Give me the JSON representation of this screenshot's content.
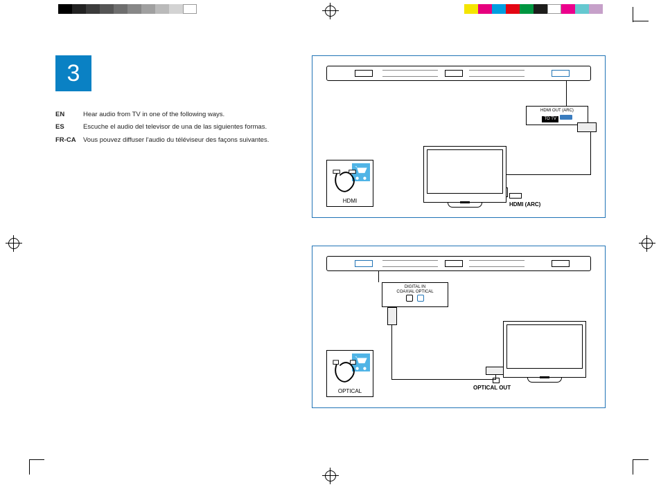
{
  "step_number": "3",
  "languages": [
    {
      "code": "EN",
      "text": "Hear audio from TV in one of the following ways."
    },
    {
      "code": "ES",
      "text": "Escuche el audio del televisor de una de las siguientes formas."
    },
    {
      "code": "FR-CA",
      "text": "Vous pouvez diffuser l'audio du téléviseur des façons suivantes."
    }
  ],
  "diagram_hdmi": {
    "cable_label": "HDMI",
    "tv_port_label": "HDMI (ARC)",
    "callout_line1": "HDMI OUT (ARC)",
    "callout_line2": "TO TV"
  },
  "diagram_optical": {
    "cable_label": "OPTICAL",
    "tv_port_label": "OPTICAL OUT",
    "callout_line1": "DIGITAL IN",
    "callout_line2": "COAXIAL   OPTICAL"
  },
  "color_bar_left": [
    "#000000",
    "#222222",
    "#3b3b3b",
    "#555555",
    "#6e6e6e",
    "#878787",
    "#a0a0a0",
    "#bababa",
    "#d3d3d3",
    "#ffffff"
  ],
  "color_bar_right": [
    "#f4e500",
    "#e6007e",
    "#009ee0",
    "#e30613",
    "#009640",
    "#1d1d1b",
    "#ffffff",
    "#ec008c",
    "#65c8d0",
    "#c6a0c9"
  ],
  "accent_blue": "#1f73b5"
}
